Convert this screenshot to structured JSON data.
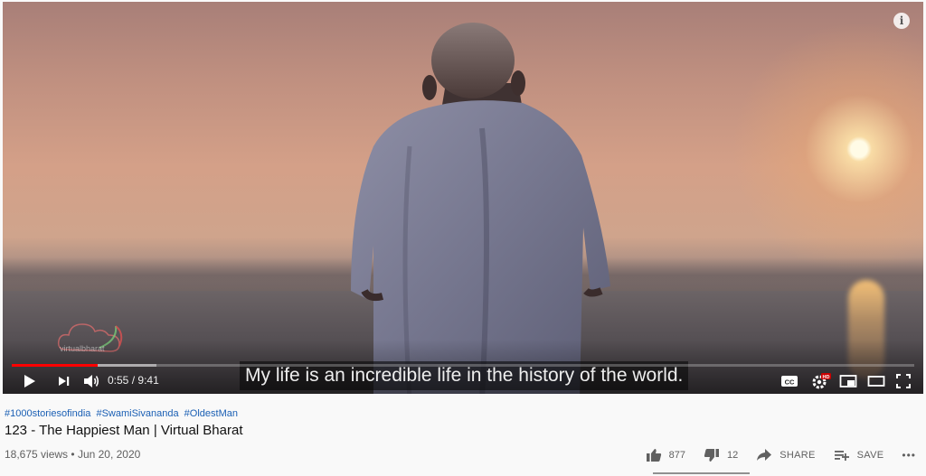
{
  "video": {
    "subtitle": "My life is an incredible life in the history of the world.",
    "current_time": "0:55",
    "duration": "9:41",
    "time_separator": "/",
    "played_fraction": 0.095,
    "buffered_fraction": 0.16,
    "watermark": "virtualbharat",
    "info_glyph": "i"
  },
  "controls": {
    "play_icon": "play-icon",
    "next_icon": "next-icon",
    "volume_icon": "volume-icon",
    "cc_label": "CC",
    "hd_badge": "HD",
    "settings_icon": "gear-icon",
    "miniplayer_icon": "miniplayer-icon",
    "theater_icon": "theater-icon",
    "fullscreen_icon": "fullscreen-icon"
  },
  "hashtags": [
    "#1000storiesofindia",
    "#SwamiSivananda",
    "#OldestMan"
  ],
  "title": "123 - The Happiest Man | Virtual Bharat",
  "views": "18,675 views",
  "separator": "•",
  "date": "Jun 20, 2020",
  "actions": {
    "likes": "877",
    "dislikes": "12",
    "share": "SHARE",
    "save": "SAVE",
    "more": "•••"
  },
  "colors": {
    "progress_played": "#ff0000",
    "link": "#1a5fb4"
  }
}
